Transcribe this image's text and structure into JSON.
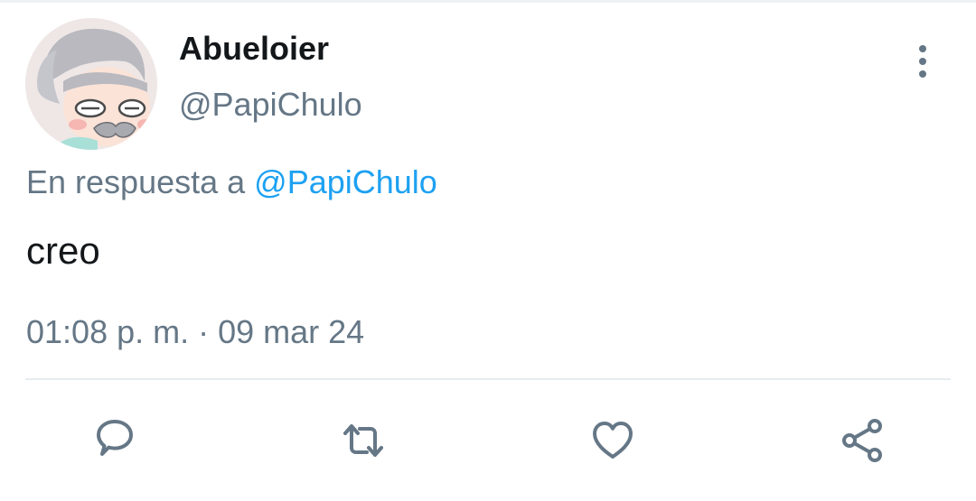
{
  "user": {
    "display_name": "Abueloier",
    "handle": "@PapiChulo"
  },
  "reply": {
    "prefix": "En respuesta a",
    "mention": "@PapiChulo"
  },
  "tweet": {
    "text": "creo",
    "timestamp": "01:08 p. m. · 09 mar 24"
  },
  "actions": [
    {
      "icon": "reply-icon"
    },
    {
      "icon": "retweet-icon"
    },
    {
      "icon": "heart-icon"
    },
    {
      "icon": "share-icon"
    }
  ],
  "colors": {
    "text_primary": "#14171a",
    "text_secondary": "#657786",
    "link": "#1da1f2",
    "divider": "#e6ecf0"
  }
}
